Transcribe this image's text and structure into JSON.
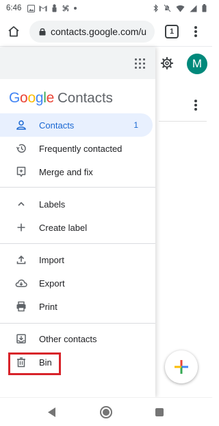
{
  "status_bar": {
    "time": "6:46",
    "left_icons": [
      "image-icon",
      "gmail-icon",
      "android-icon",
      "pinwheel-icon",
      "dot-icon"
    ],
    "right_icons": [
      "bluetooth-icon",
      "mute-icon",
      "wifi-icon",
      "signal-icon",
      "battery-icon"
    ]
  },
  "browser": {
    "url": "contacts.google.com/u",
    "tab_count": "1"
  },
  "app": {
    "brand_google": "Google",
    "brand_product": "Contacts",
    "avatar_letter": "M"
  },
  "drawer": {
    "items": [
      {
        "label": "Contacts",
        "count": "1",
        "icon": "person-icon",
        "active": true
      },
      {
        "label": "Frequently contacted",
        "icon": "history-icon"
      },
      {
        "label": "Merge and fix",
        "icon": "merge-fix-icon"
      }
    ],
    "labels_section": {
      "label": "Labels",
      "icon": "chevron-up-icon"
    },
    "create_label": {
      "label": "Create label",
      "icon": "plus-icon"
    },
    "data_items": [
      {
        "label": "Import",
        "icon": "upload-icon"
      },
      {
        "label": "Export",
        "icon": "cloud-download-icon"
      },
      {
        "label": "Print",
        "icon": "print-icon"
      }
    ],
    "bottom_items": [
      {
        "label": "Other contacts",
        "icon": "archive-icon"
      },
      {
        "label": "Bin",
        "icon": "trash-icon"
      }
    ]
  },
  "colors": {
    "active_bg": "#e8f0fe",
    "active_text": "#1967d2",
    "highlight": "#d8232a",
    "avatar_bg": "#00897b"
  }
}
